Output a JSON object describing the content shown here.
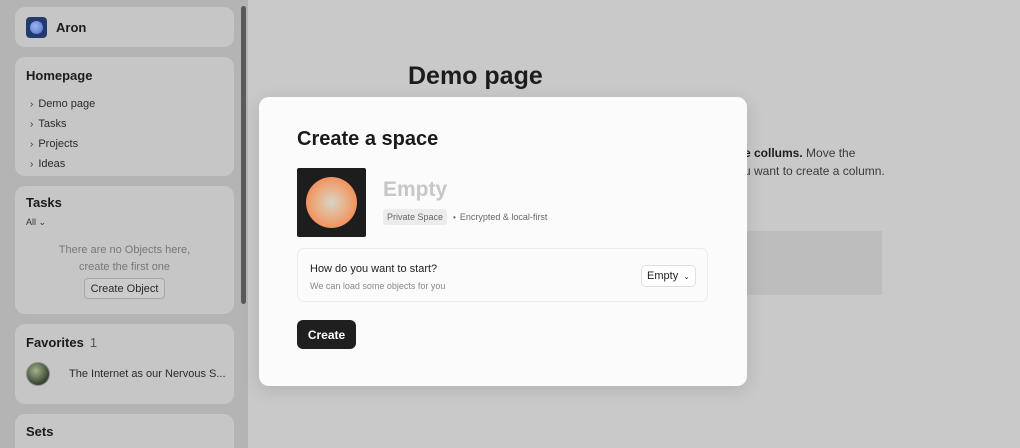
{
  "account": {
    "name": "Aron"
  },
  "homepage": {
    "title": "Homepage",
    "items": [
      {
        "label": "Demo page"
      },
      {
        "label": "Tasks"
      },
      {
        "label": "Projects"
      },
      {
        "label": "Ideas"
      }
    ]
  },
  "tasks": {
    "title": "Tasks",
    "filter": "All",
    "empty_line1": "There are no Objects here,",
    "empty_line2": "create the first one",
    "create_button": "Create Object"
  },
  "favorites": {
    "title": "Favorites",
    "count": "1",
    "items": [
      {
        "label": "The Internet as our Nervous S..."
      }
    ]
  },
  "sets": {
    "title": "Sets"
  },
  "page": {
    "title": "Demo page",
    "text_bold": "e collums.",
    "text_rest": " Move the",
    "text_line2": "u want to create a column."
  },
  "modal": {
    "title": "Create a space",
    "space_name": "Empty",
    "badge": "Private Space",
    "meta": "Encrypted & local-first",
    "question": "How do you want to start?",
    "subtext": "We can load some objects for you",
    "select_value": "Empty",
    "create_button": "Create"
  },
  "icons": {
    "chevron": "chevron-right-icon",
    "caret": "chevron-down-icon"
  }
}
